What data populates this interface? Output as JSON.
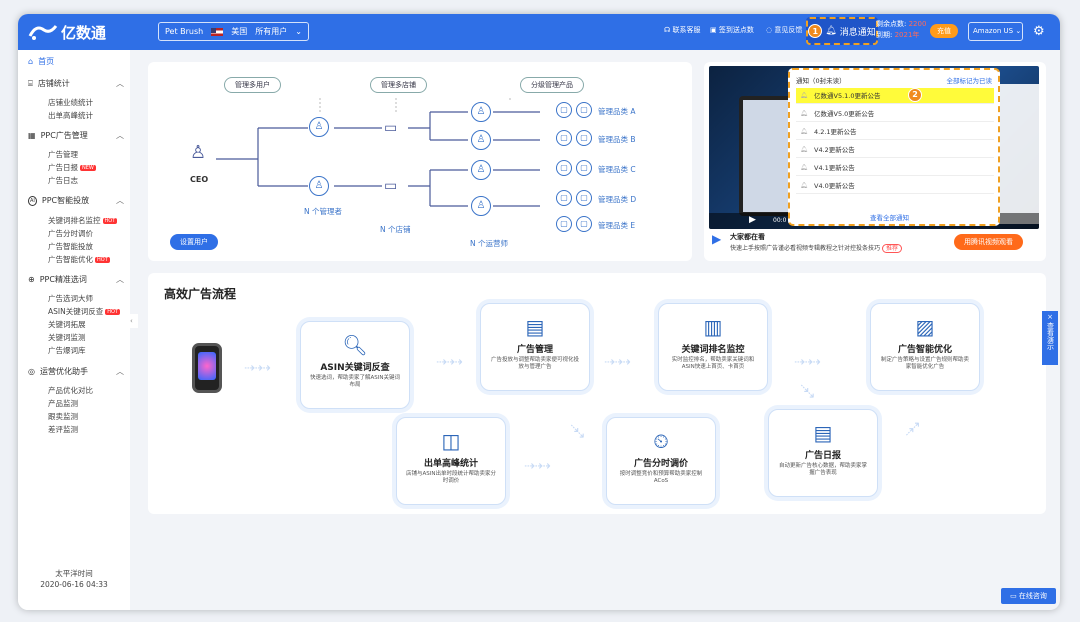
{
  "header": {
    "logo": "亿数通",
    "store": "Pet Brush",
    "country": "美国",
    "users": "所有用户",
    "contact": "联系客服",
    "signin": "签到送点数",
    "feedback": "意见反馈",
    "notice": "消息通知",
    "balance_label": "剩余点数:",
    "balance_value": "2200",
    "expiry_label": "到期:",
    "expiry_value": "2021年",
    "charge": "充值",
    "market": "Amazon US"
  },
  "callouts": [
    "1",
    "2"
  ],
  "sidebar": {
    "home": "首页",
    "groups": [
      {
        "title": "店铺统计",
        "items": [
          "店铺业绩统计",
          "出单高峰统计"
        ]
      },
      {
        "title": "PPC广告管理",
        "items": [
          "广告管理",
          "广告日报",
          "广告日志"
        ]
      },
      {
        "title": "PPC智能投放",
        "items": [
          "关键词排名监控",
          "广告分时调价",
          "广告智能投放",
          "广告智能优化"
        ]
      },
      {
        "title": "PPC精准选词",
        "items": [
          "广告选词大师",
          "ASIN关键词反查",
          "关键词拓展",
          "关键词监测",
          "广告爆词库"
        ]
      },
      {
        "title": "运营优化助手",
        "items": [
          "产品优化对比",
          "产品监测",
          "跟卖监测",
          "差评监测"
        ]
      }
    ],
    "tags": {
      "new": "NEW",
      "hot": "HOT"
    },
    "timezone": "太平洋时间",
    "datetime": "2020-06-16 04:33"
  },
  "org": {
    "pills": [
      "管理多用户",
      "管理多店铺",
      "分级管理产品"
    ],
    "ceo": "CEO",
    "managers": "N 个管理者",
    "stores": "N 个店铺",
    "operators": "N 个运营师",
    "categories": [
      "管理品类 A",
      "管理品类 B",
      "管理品类 C",
      "管理品类 D",
      "管理品类 E"
    ],
    "setup_button": "设置用户"
  },
  "video": {
    "title": "大家都在看",
    "desc": "快速上手按照广告谨必看视频专辑教程之针对控投条技巧",
    "tag": "推荐",
    "button": "用腾讯视频观看",
    "time": "00:0"
  },
  "notifications": {
    "header": "通知（0封未读）",
    "mark_all": "全部标记为已读",
    "items": [
      "亿数通V5.1.0更新公告",
      "亿数通V5.0更新公告",
      "4.2.1更新公告",
      "V4.2更新公告",
      "V4.1更新公告",
      "V4.0更新公告"
    ],
    "view_all": "查看全部通知"
  },
  "flow": {
    "title": "高效广告流程",
    "steps": [
      {
        "title": "ASIN关键词反查",
        "desc": "快速选词，帮助卖家了解ASIN关键词布局"
      },
      {
        "title": "广告管理",
        "desc": "广告投放与调整帮助卖家便可视化投放与管理广告"
      },
      {
        "title": "关键词排名监控",
        "desc": "实时监控排名，帮助卖家关键词和ASIN快速上首页、卡首页"
      },
      {
        "title": "广告智能优化",
        "desc": "制定广告策略与设置广告规则帮助卖家智能优化广告"
      },
      {
        "title": "出单高峰统计",
        "desc": "店铺与ASIN出单时段统计帮助卖家分时调价"
      },
      {
        "title": "广告分时调价",
        "desc": "按时调整竞价和预算帮助卖家控制ACoS"
      },
      {
        "title": "广告日报",
        "desc": "自动更新广告核心数据，帮助卖家掌握广告表现"
      }
    ]
  },
  "float": {
    "demo": "查看演示",
    "chat": "在线咨询"
  }
}
